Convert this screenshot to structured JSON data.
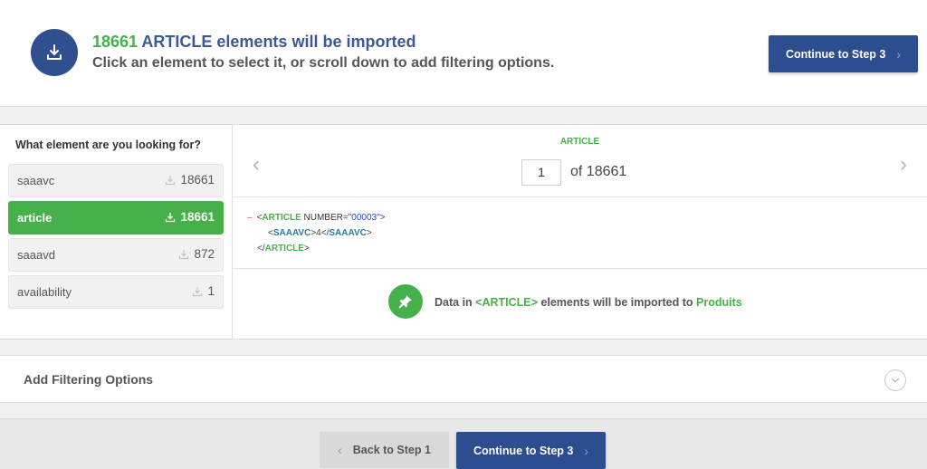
{
  "header": {
    "count": "18661",
    "headline_rest": "ARTICLE elements will be imported",
    "subline": "Click an element to select it, or scroll down to add filtering options.",
    "continue_label": "Continue to Step 3",
    "icon": "download-icon"
  },
  "sidebar": {
    "question": "What element are you looking for?",
    "items": [
      {
        "name": "saaavc",
        "count": "18661",
        "active": false
      },
      {
        "name": "article",
        "count": "18661",
        "active": true
      },
      {
        "name": "saaavd",
        "count": "872",
        "active": false
      },
      {
        "name": "availability",
        "count": "1",
        "active": false
      }
    ]
  },
  "viewer": {
    "element_tag": "ARTICLE",
    "page_value": "1",
    "of_text": "of 18661",
    "xml": {
      "minus": "–",
      "open_tag": "ARTICLE",
      "attr_name": "NUMBER",
      "attr_value": "\"00003\"",
      "child_tag": "SAAAVC",
      "child_text": "4",
      "close_tag": "ARTICLE"
    },
    "import_text_pre": "Data in",
    "import_text_tag": "<ARTICLE>",
    "import_text_mid": "elements will be imported to",
    "import_text_target": "Produits"
  },
  "filtering": {
    "title": "Add Filtering Options"
  },
  "footer": {
    "back_label": "Back to Step 1",
    "continue_label": "Continue to Step 3"
  },
  "colors": {
    "brand_blue": "#2c4d8f",
    "accent_green": "#46b04a"
  }
}
